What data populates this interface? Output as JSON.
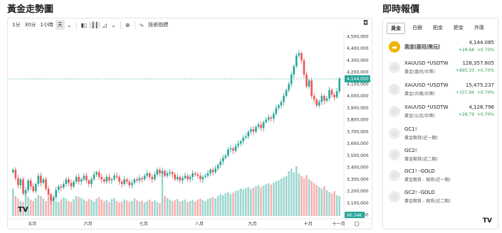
{
  "left_title": "黃金走勢圖",
  "right_title": "即時報價",
  "toolbar": {
    "intervals": [
      "1分",
      "30分",
      "1小時",
      "天"
    ],
    "active_interval": "天",
    "indicators_label": "技術指標"
  },
  "chart_data": {
    "type": "candlestick",
    "title": "",
    "y_ticks": [
      "4,500,000",
      "4,400,000",
      "4,300,000",
      "4,200,000",
      "4,100,000",
      "4,000,000",
      "3,900,000",
      "3,800,000",
      "3,700,000",
      "3,600,000",
      "3,500,000",
      "3,400,000",
      "3,300,000",
      "3,200,000",
      "3,100,000",
      "3,000,000"
    ],
    "y_tick_values": [
      4500000,
      4400000,
      4300000,
      4200000,
      4100000,
      4000000,
      3900000,
      3800000,
      3700000,
      3600000,
      3500000,
      3400000,
      3300000,
      3200000,
      3100000,
      3000000
    ],
    "ylim": [
      2980000,
      4520000
    ],
    "x_labels": [
      "五月",
      "六月",
      "七月",
      "八月",
      "九月",
      "十月",
      "十一月"
    ],
    "last_price_label": "4,144,050",
    "last_price": 4144050,
    "volume_label": "90.34K",
    "up_color": "#26a69a",
    "down_color": "#ef5350",
    "closes": [
      3380000,
      3310000,
      3250000,
      3300000,
      3180000,
      3210000,
      3290000,
      3240000,
      3200000,
      3260000,
      3330000,
      3270000,
      3300000,
      3220000,
      3170000,
      3120000,
      3150000,
      3210000,
      3240000,
      3230000,
      3260000,
      3300000,
      3270000,
      3240000,
      3280000,
      3320000,
      3280000,
      3300000,
      3330000,
      3290000,
      3260000,
      3300000,
      3340000,
      3360000,
      3320000,
      3300000,
      3280000,
      3320000,
      3290000,
      3300000,
      3330000,
      3320000,
      3280000,
      3260000,
      3300000,
      3280000,
      3250000,
      3270000,
      3300000,
      3290000,
      3310000,
      3300000,
      3330000,
      3350000,
      3320000,
      3300000,
      3340000,
      3380000,
      3350000,
      3370000,
      3330000,
      3350000,
      3360000,
      3340000,
      3300000,
      3320000,
      3290000,
      3310000,
      3330000,
      3300000,
      3320000,
      3350000,
      3340000,
      3330000,
      3300000,
      3320000,
      3330000,
      3350000,
      3380000,
      3360000,
      3390000,
      3420000,
      3450000,
      3480000,
      3500000,
      3550000,
      3560000,
      3540000,
      3580000,
      3600000,
      3620000,
      3650000,
      3660000,
      3700000,
      3720000,
      3700000,
      3740000,
      3760000,
      3730000,
      3780000,
      3800000,
      3820000,
      3810000,
      3850000,
      3900000,
      3920000,
      3950000,
      4000000,
      4050000,
      4100000,
      4180000,
      4250000,
      4340000,
      4360000,
      4300000,
      4180000,
      4080000,
      4130000,
      4000000,
      3970000,
      3920000,
      3950000,
      4000000,
      3960000,
      3980000,
      4050000,
      4010000,
      3990000,
      4040000,
      4144050
    ],
    "volumes": [
      55,
      40,
      35,
      30,
      28,
      45,
      38,
      33,
      30,
      36,
      42,
      40,
      35,
      30,
      38,
      44,
      36,
      30,
      28,
      33,
      37,
      35,
      30,
      28,
      34,
      40,
      38,
      36,
      33,
      30,
      34,
      32,
      29,
      35,
      38,
      33,
      30,
      32,
      28,
      34,
      36,
      30,
      27,
      29,
      33,
      31,
      28,
      30,
      35,
      32,
      29,
      31,
      27,
      30,
      33,
      29,
      31,
      28,
      26,
      85,
      40,
      36,
      33,
      30,
      32,
      34,
      29,
      31,
      33,
      28,
      30,
      32,
      29,
      33,
      35,
      32,
      30,
      34,
      36,
      38,
      35,
      40,
      44,
      42,
      46,
      48,
      44,
      47,
      50,
      52,
      55,
      53,
      56,
      58,
      54,
      57,
      60,
      62,
      58,
      61,
      64,
      66,
      63,
      67,
      70,
      72,
      75,
      78,
      80,
      90,
      95,
      88,
      100,
      85,
      80,
      76,
      82,
      74,
      70,
      66,
      62,
      58,
      55,
      60,
      52,
      48,
      45,
      50,
      42,
      40
    ]
  },
  "tabs": [
    "黃金",
    "白銀",
    "鉑金",
    "鈀金",
    "外匯"
  ],
  "active_tab": "黃金",
  "quotes": [
    {
      "icon": "gold-bar-icon",
      "symbol": "",
      "name": "黃金(盎司/美元)",
      "price": "4,144.085",
      "change": "+28.68",
      "change_pct": "+0.70%"
    },
    {
      "icon": "placeholder-icon",
      "symbol": "XAUUSD *USDTWD",
      "name": "黃金(盎司/台幣)",
      "price": "128,357.805",
      "change": "+895.33",
      "change_pct": "+0.70%"
    },
    {
      "icon": "placeholder-icon",
      "symbol": "XAUUSD *USDTWD",
      "name": "黃金(台兩/台幣)",
      "price": "15,475.237",
      "change": "+107.94",
      "change_pct": "+0.70%"
    },
    {
      "icon": "placeholder-icon",
      "symbol": "XAUUSD *USDTWD/",
      "name": "黃金(公克/台幣)",
      "price": "4,126.796",
      "change": "+28.79",
      "change_pct": "+0.70%"
    },
    {
      "icon": "placeholder-icon",
      "symbol": "GC1!",
      "name": "黃金期貨(近一期)",
      "price": "",
      "change": "",
      "change_pct": ""
    },
    {
      "icon": "placeholder-icon",
      "symbol": "GC2!",
      "name": "黃金期貨(近二期)",
      "price": "",
      "change": "",
      "change_pct": ""
    },
    {
      "icon": "placeholder-icon",
      "symbol": "GC1! -GOLD",
      "name": "黃金期貨 - 現貨(近一期)",
      "price": "",
      "change": "",
      "change_pct": ""
    },
    {
      "icon": "placeholder-icon",
      "symbol": "GC2! -GOLD",
      "name": "黃金期貨 - 現貨(近二期)",
      "price": "",
      "change": "",
      "change_pct": ""
    }
  ],
  "error_badge": "!"
}
